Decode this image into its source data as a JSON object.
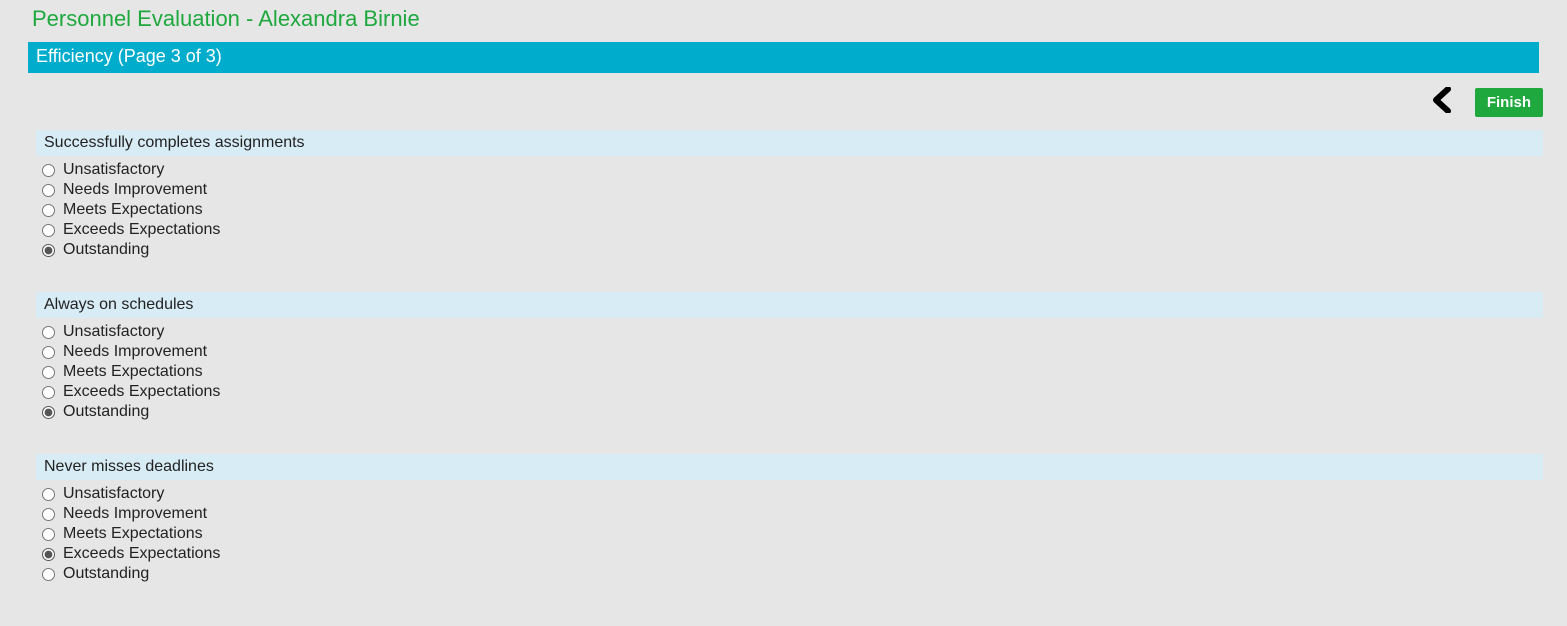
{
  "title": "Personnel Evaluation - Alexandra Birnie",
  "section_header": "Efficiency (Page 3 of 3)",
  "nav": {
    "finish_label": "Finish"
  },
  "option_labels": [
    "Unsatisfactory",
    "Needs Improvement",
    "Meets Expectations",
    "Exceeds Expectations",
    "Outstanding"
  ],
  "questions": [
    {
      "title": "Successfully completes assignments",
      "selected_index": 4
    },
    {
      "title": "Always on schedules",
      "selected_index": 4
    },
    {
      "title": "Never misses deadlines",
      "selected_index": 3
    }
  ]
}
